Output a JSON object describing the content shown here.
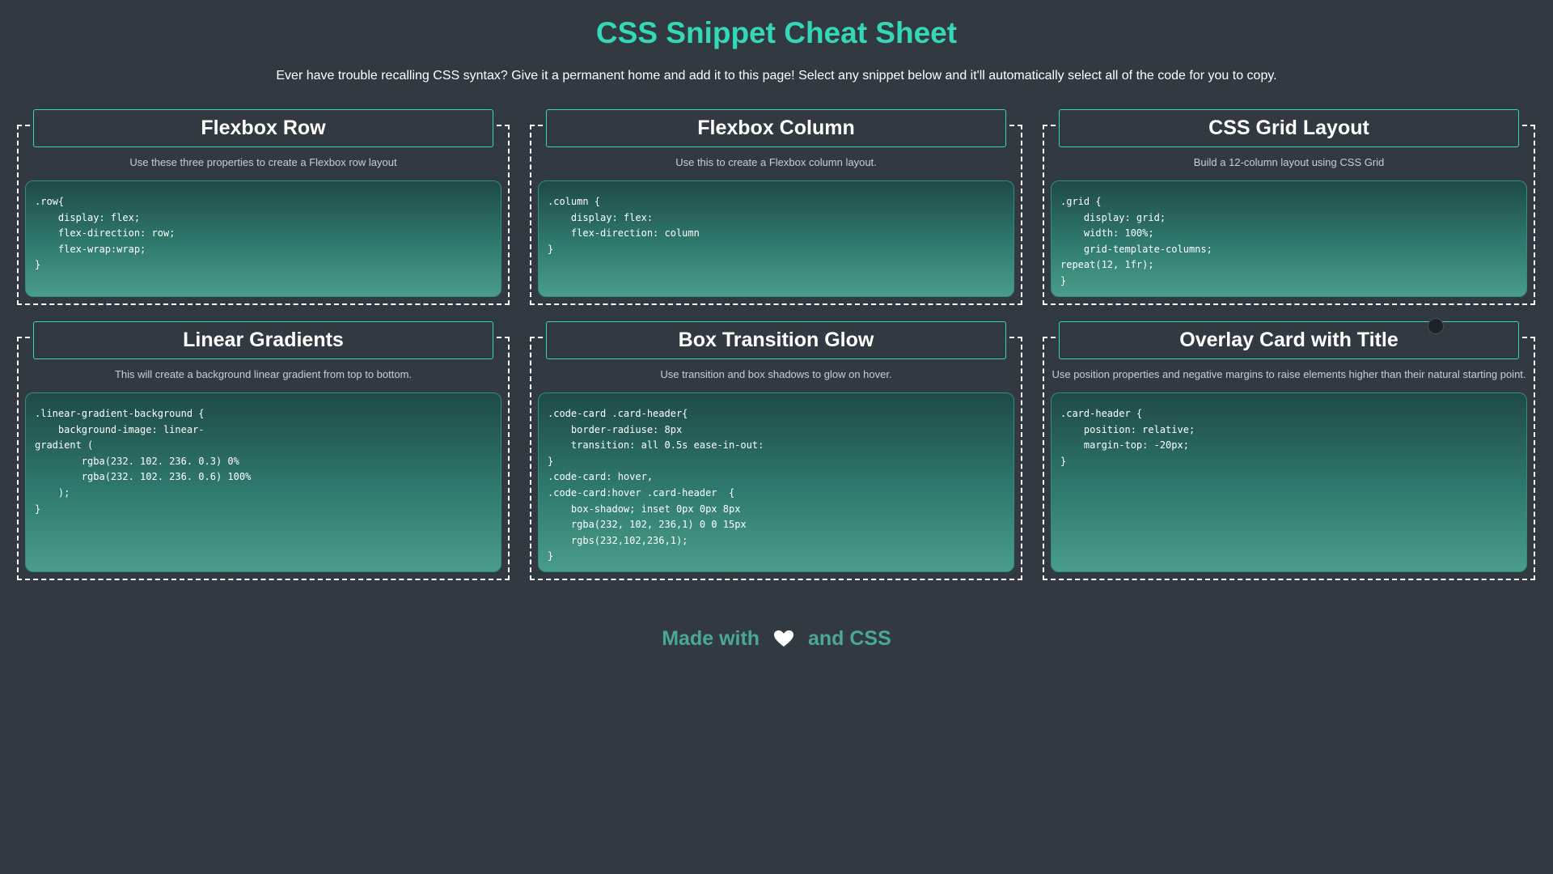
{
  "page": {
    "title": "CSS Snippet Cheat Sheet",
    "subtitle": "Ever have trouble recalling CSS syntax? Give it a permanent home and add it to this page! Select any snippet below and it'll automatically select all of the code for you to copy."
  },
  "cards": [
    {
      "title": "Flexbox Row",
      "description": "Use these three properties to create a Flexbox row layout",
      "code": ".row{\n    display: flex;\n    flex-direction: row;\n    flex-wrap:wrap;\n}"
    },
    {
      "title": "Flexbox Column",
      "description": "Use this to create a Flexbox column layout.",
      "code": ".column {\n    display: flex:\n    flex-direction: column\n}"
    },
    {
      "title": "CSS Grid Layout",
      "description": "Build a 12-column layout using CSS Grid",
      "code": ".grid {\n    display: grid;\n    width: 100%;\n    grid-template-columns;\nrepeat(12, 1fr);\n}"
    },
    {
      "title": "Linear Gradients",
      "description": "This will create a background linear gradient from top to bottom.",
      "code": ".linear-gradient-background {\n    background-image: linear-\ngradient (\n        rgba(232. 102. 236. 0.3) 0%\n        rgba(232. 102. 236. 0.6) 100%\n    );\n}"
    },
    {
      "title": "Box Transition Glow",
      "description": "Use transition and box shadows to glow on hover.",
      "code": ".code-card .card-header{\n    border-radiuse: 8px\n    transition: all 0.5s ease-in-out:\n}\n.code-card: hover,\n.code-card:hover .card-header  {\n    box-shadow; inset 0px 0px 8px\n    rgba(232, 102, 236,1) 0 0 15px\n    rgbs(232,102,236,1);\n}"
    },
    {
      "title": "Overlay Card with Title",
      "description": "Use position properties and negative margins to raise elements higher than their natural starting point.",
      "code": ".card-header {\n    position: relative;\n    margin-top: -20px;\n}"
    }
  ],
  "footer": {
    "prefix": "Made with",
    "heart_icon": "white-heart",
    "suffix": "and CSS"
  },
  "colors": {
    "background": "#323941",
    "accent": "#33d9b7",
    "footer_text": "#4aa894"
  }
}
